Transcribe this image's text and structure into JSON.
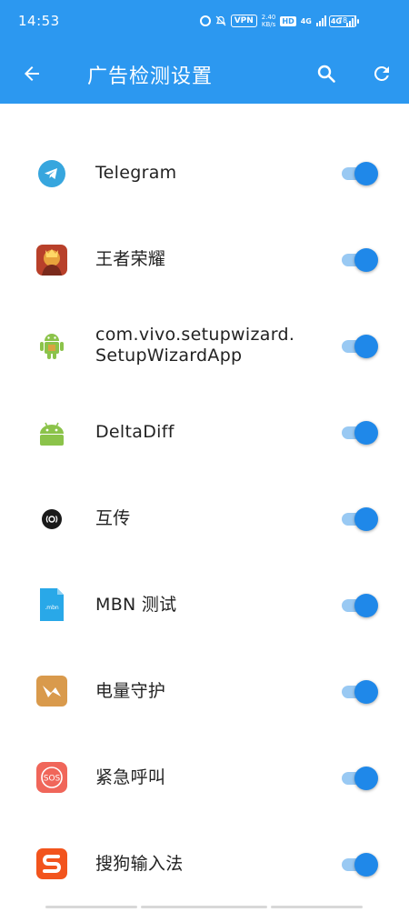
{
  "status_bar": {
    "time": "14:53",
    "vpn": "VPN",
    "net_speed_value": "2.40",
    "net_speed_unit": "KB/s",
    "hd": "HD",
    "sim_label_1": "4G",
    "sim_label_2": "4G",
    "battery": "78"
  },
  "app_bar": {
    "title": "广告检测设置",
    "icons": [
      "back-arrow-icon",
      "search-icon",
      "refresh-icon"
    ]
  },
  "apps": [
    {
      "name": "Telegram",
      "icon": "telegram-icon",
      "enabled": true
    },
    {
      "name": "王者荣耀",
      "icon": "honor-of-kings-icon",
      "enabled": true
    },
    {
      "name": "com.vivo.setupwizard.\nSetupWizardApp",
      "icon": "android-package-icon",
      "enabled": true
    },
    {
      "name": "DeltaDiff",
      "icon": "android-icon",
      "enabled": true
    },
    {
      "name": "互传",
      "icon": "easyshare-icon",
      "enabled": true
    },
    {
      "name": "MBN 测试",
      "icon": "mbn-file-icon",
      "enabled": true,
      "icon_text": ".mbn"
    },
    {
      "name": "电量守护",
      "icon": "battery-guard-icon",
      "enabled": true
    },
    {
      "name": "紧急呼叫",
      "icon": "sos-icon",
      "enabled": true,
      "icon_text": "SOS"
    },
    {
      "name": "搜狗输入法",
      "icon": "sogou-input-icon",
      "enabled": true
    }
  ],
  "colors": {
    "primary": "#2c98f0",
    "toggle_thumb": "#1f88e9",
    "toggle_track": "#99c9f3"
  }
}
